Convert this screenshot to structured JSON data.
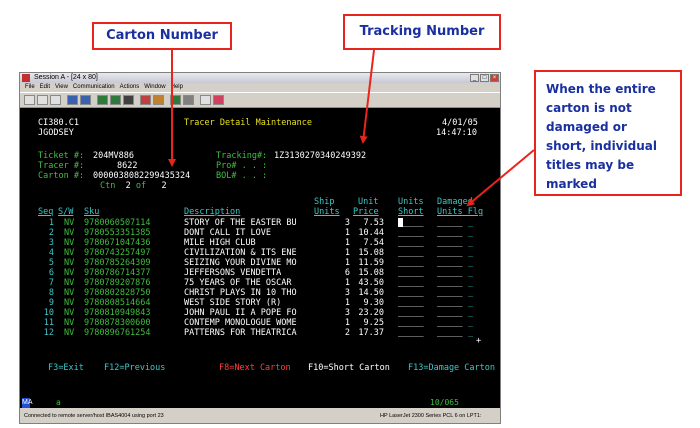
{
  "callouts": {
    "carton": "Carton Number",
    "tracking": "Tracking Number",
    "damaged": "When the entire carton is not damaged or short, individual titles may be marked"
  },
  "window": {
    "title": "Session A - [24 x 80]",
    "menu": [
      "File",
      "Edit",
      "View",
      "Communication",
      "Actions",
      "Window",
      "Help"
    ]
  },
  "screen": {
    "program": "CI380.C1",
    "user": "JGODSEY",
    "title": "Tracer Detail Maintenance",
    "date": "4/01/05",
    "time": "14:47:10",
    "ticket_label": "Ticket #:",
    "ticket": "204MV886",
    "tracer_label": "Tracer #:",
    "tracer": "8622",
    "carton_label": "Carton #:",
    "carton": "00000380822994353",
    "carton_tail": "24",
    "tracking_label": "Tracking#:",
    "tracking": "1Z3130270340249392",
    "pro_label": "Pro# . . :",
    "bol_label": "BOL# . . :",
    "ctn_label": "Ctn",
    "ctn_current": "2",
    "ctn_of": "of",
    "ctn_total": "2",
    "headers": {
      "seq": "Seq",
      "sw": "S/W",
      "sku": "Sku",
      "description": "Description",
      "ship_top": "Ship",
      "ship_bottom": "Units",
      "unit_top": "Unit",
      "unit_bottom": "Price",
      "short_top": "Units",
      "short_bottom": "Short",
      "damaged_top": "Damaged",
      "damaged_bottom": "Units Flg"
    },
    "rows": [
      {
        "seq": "1",
        "sw": "NV",
        "sku": "9780060507114",
        "desc": "STORY OF THE EASTER BU",
        "units": "3",
        "price": "7.53"
      },
      {
        "seq": "2",
        "sw": "NV",
        "sku": "9780553351385",
        "desc": "DONT CALL IT LOVE",
        "units": "1",
        "price": "10.44"
      },
      {
        "seq": "3",
        "sw": "NV",
        "sku": "9780671047436",
        "desc": "MILE HIGH CLUB",
        "units": "1",
        "price": "7.54"
      },
      {
        "seq": "4",
        "sw": "NV",
        "sku": "9780743257497",
        "desc": "CIVILIZATION & ITS ENE",
        "units": "1",
        "price": "15.08"
      },
      {
        "seq": "5",
        "sw": "NV",
        "sku": "9780785264309",
        "desc": "SEIZING YOUR DIVINE MO",
        "units": "1",
        "price": "11.59"
      },
      {
        "seq": "6",
        "sw": "NV",
        "sku": "9780786714377",
        "desc": "JEFFERSONS VENDETTA",
        "units": "6",
        "price": "15.08"
      },
      {
        "seq": "7",
        "sw": "NV",
        "sku": "9780789207876",
        "desc": "75 YEARS OF THE OSCAR",
        "units": "1",
        "price": "43.50"
      },
      {
        "seq": "8",
        "sw": "NV",
        "sku": "9780802828750",
        "desc": "CHRIST PLAYS IN 10 THO",
        "units": "3",
        "price": "14.50"
      },
      {
        "seq": "9",
        "sw": "NV",
        "sku": "9780808514664",
        "desc": "WEST SIDE STORY (R)",
        "units": "1",
        "price": "9.30"
      },
      {
        "seq": "10",
        "sw": "NV",
        "sku": "9780810949843",
        "desc": "JOHN PAUL II A POPE FO",
        "units": "3",
        "price": "23.20"
      },
      {
        "seq": "11",
        "sw": "NV",
        "sku": "9780878300600",
        "desc": "CONTEMP MONOLOGUE WOME",
        "units": "1",
        "price": "9.25"
      },
      {
        "seq": "12",
        "sw": "NV",
        "sku": "9780896761254",
        "desc": "PATTERNS FOR THEATRICA",
        "units": "2",
        "price": "17.37"
      }
    ],
    "more_marker": "+",
    "fkeys": {
      "f3": "F3=Exit",
      "f12": "F12=Previous",
      "f8": "F8=Next Carton",
      "f10": "F10=Short Carton",
      "f13": "F13=Damage Carton"
    }
  },
  "oia": {
    "marker": "MA",
    "indicator": "a",
    "cursor_pos": "10/065"
  },
  "statusbar": {
    "left": "Connected to remote server/host IBAS4004 using port 23",
    "right": "HP LaserJet 2300 Series PCL 6 on LPT1:"
  },
  "colors": {
    "callout_border": "#e8241c",
    "callout_text": "#1a2fa0",
    "terminal_green": "#3fbf3f",
    "terminal_cyan": "#3cc8c8",
    "terminal_yellow": "#e8e020",
    "terminal_red": "#ff4040"
  }
}
